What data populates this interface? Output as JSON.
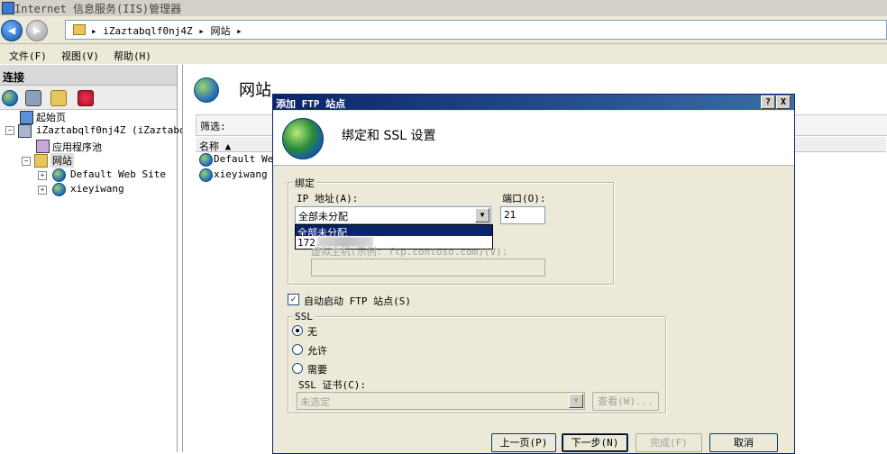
{
  "window": {
    "title": "Internet 信息服务(IIS)管理器"
  },
  "address": {
    "crumbs": [
      "iZaztabqlf0nj4Z",
      "网站"
    ]
  },
  "menu": {
    "items": [
      "文件(F)",
      "视图(V)",
      "帮助(H)"
    ]
  },
  "connections": {
    "header": "连接",
    "tree": [
      {
        "label": "起始页"
      },
      {
        "label": "iZaztabqlf0nj4Z (iZaztabql"
      },
      {
        "label": "应用程序池"
      },
      {
        "label": "网站"
      },
      {
        "label": "Default Web Site"
      },
      {
        "label": "xieyiwang"
      }
    ]
  },
  "main": {
    "title": "网站",
    "filter_label": "筛选:",
    "column_name": "名称 ▲",
    "rows": [
      "Default Web",
      "xieyiwang"
    ]
  },
  "dialog": {
    "title": "添加 FTP 站点",
    "help_btn": "?",
    "close_btn": "X",
    "heading": "绑定和 SSL 设置",
    "binding_group": "绑定",
    "ip_label": "IP 地址(A):",
    "ip_value": "全部未分配",
    "ip_options": [
      "全部未分配",
      "172.  .74"
    ],
    "port_label": "端口(O):",
    "port_value": "21",
    "virtual_host_label": "虚拟主机(示例: ftp.contoso.com)(V):",
    "virtual_host_value": "",
    "autostart_label": "自动启动 FTP 站点(S)",
    "ssl_group": "SSL",
    "ssl_options": [
      "无",
      "允许",
      "需要"
    ],
    "ssl_selected": "无",
    "ssl_cert_label": "SSL 证书(C):",
    "ssl_cert_value": "未选定",
    "view_btn": "查看(W)...",
    "buttons": {
      "prev": "上一页(P)",
      "next": "下一步(N)",
      "finish": "完成(F)",
      "cancel": "取消"
    }
  }
}
